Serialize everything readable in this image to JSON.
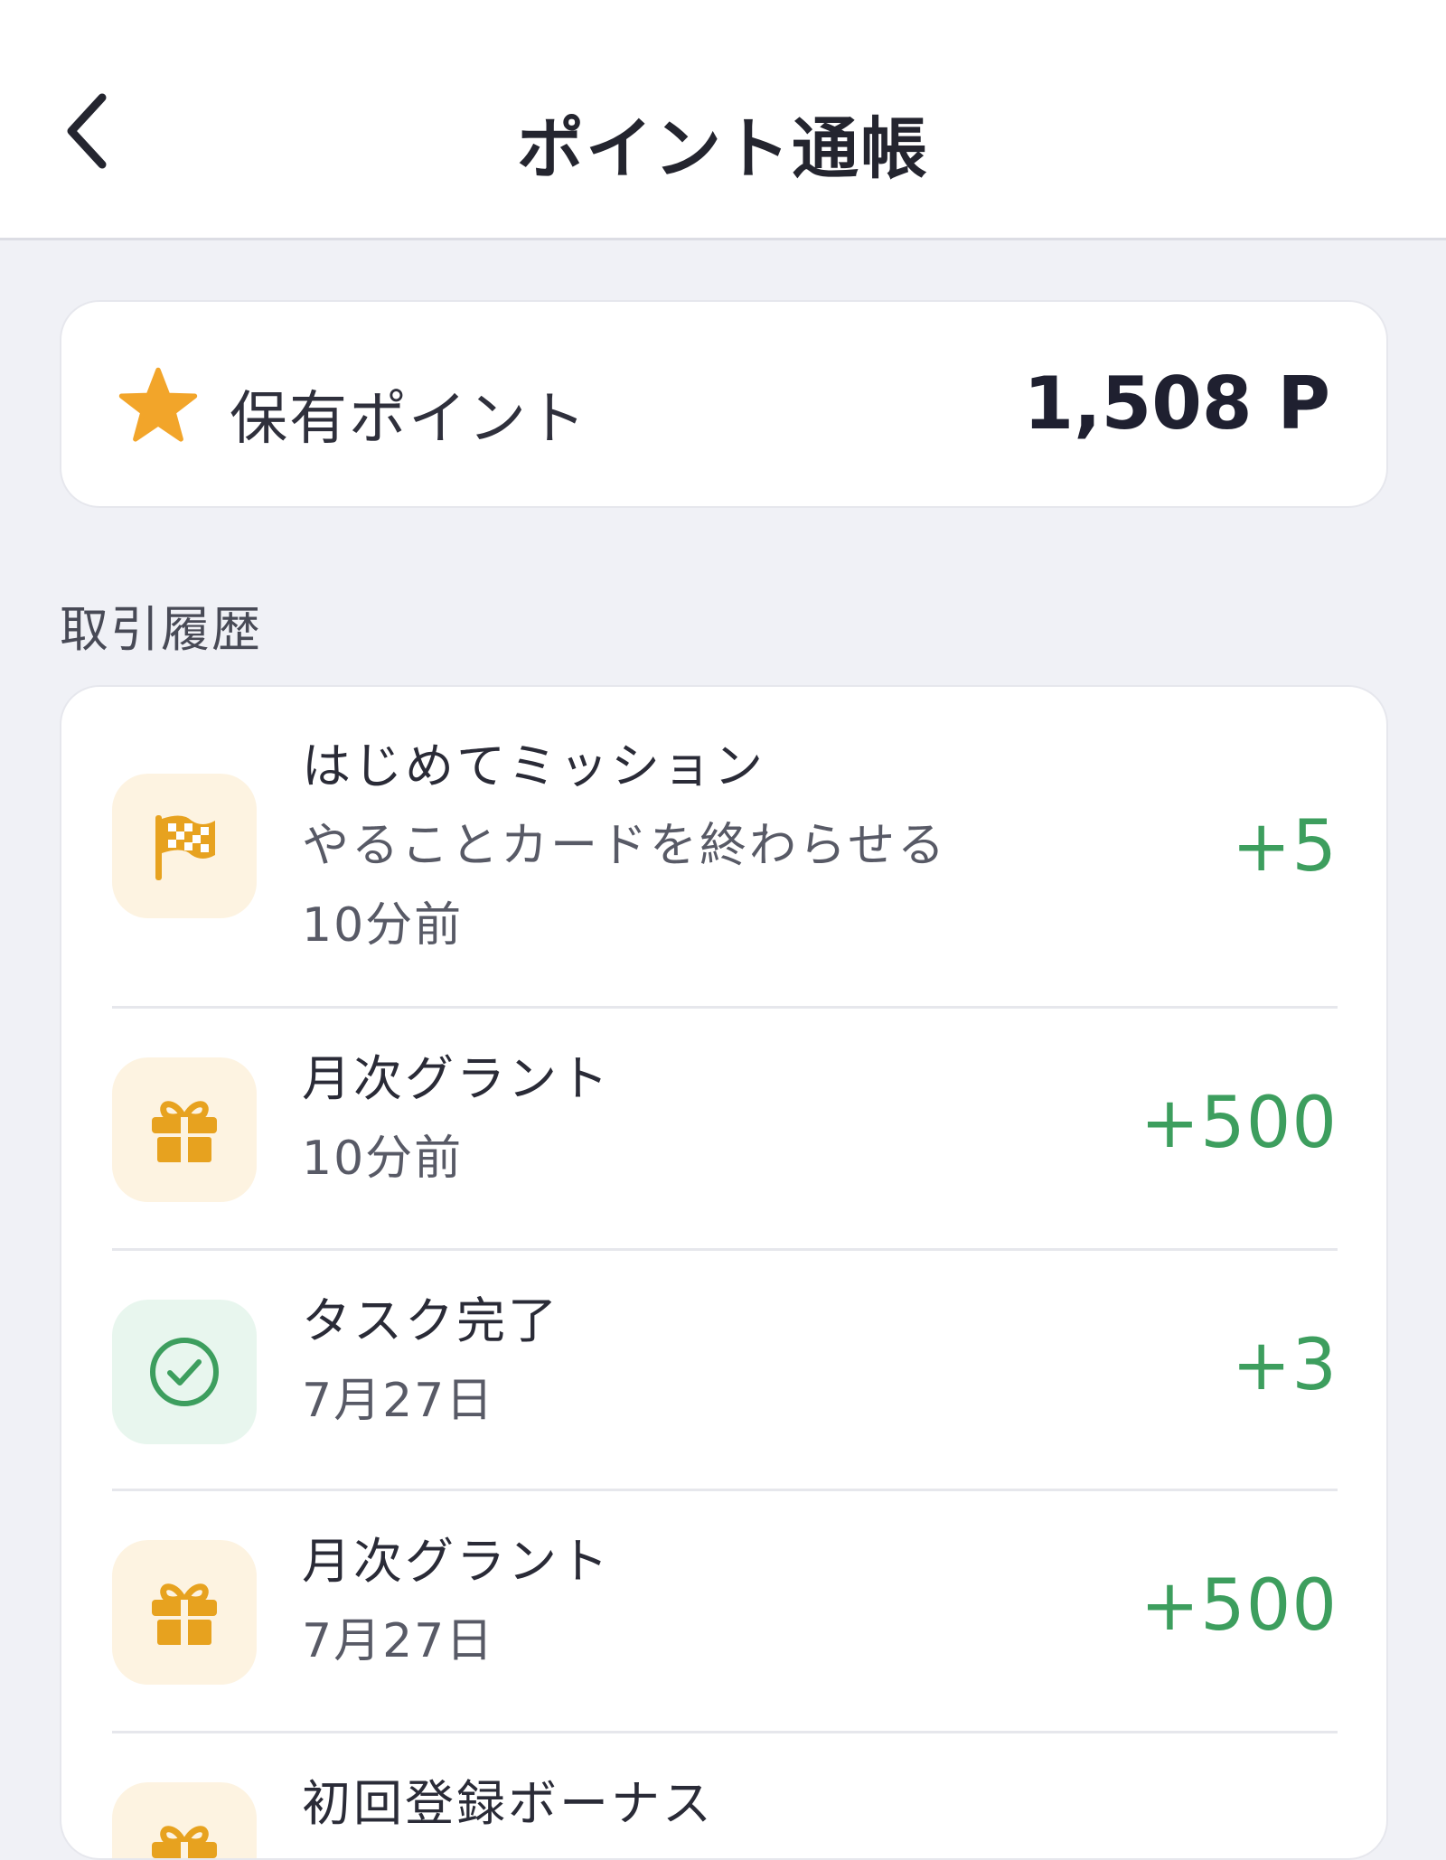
{
  "header": {
    "title": "ポイント通帳",
    "back_icon": "chevron-left-icon"
  },
  "balance": {
    "icon": "star-icon",
    "label": "保有ポイント",
    "value": "1,508 P"
  },
  "history": {
    "section_label": "取引履歴",
    "items": [
      {
        "icon": "checkered-flag-icon",
        "title": "はじめてミッション",
        "subtitle": "やることカードを終わらせる",
        "time": "10分前",
        "amount": "+5"
      },
      {
        "icon": "gift-icon",
        "title": "月次グラント",
        "time": "10分前",
        "amount": "+500"
      },
      {
        "icon": "check-circle-icon",
        "title": "タスク完了",
        "time": "7月27日",
        "amount": "+3"
      },
      {
        "icon": "gift-icon",
        "title": "月次グラント",
        "time": "7月27日",
        "amount": "+500"
      },
      {
        "icon": "gift-icon",
        "title": "初回登録ボーナス"
      }
    ]
  },
  "colors": {
    "accent_yellow": "#f2a52a",
    "positive_green": "#3d9e5e",
    "background": "#f0f1f6"
  }
}
